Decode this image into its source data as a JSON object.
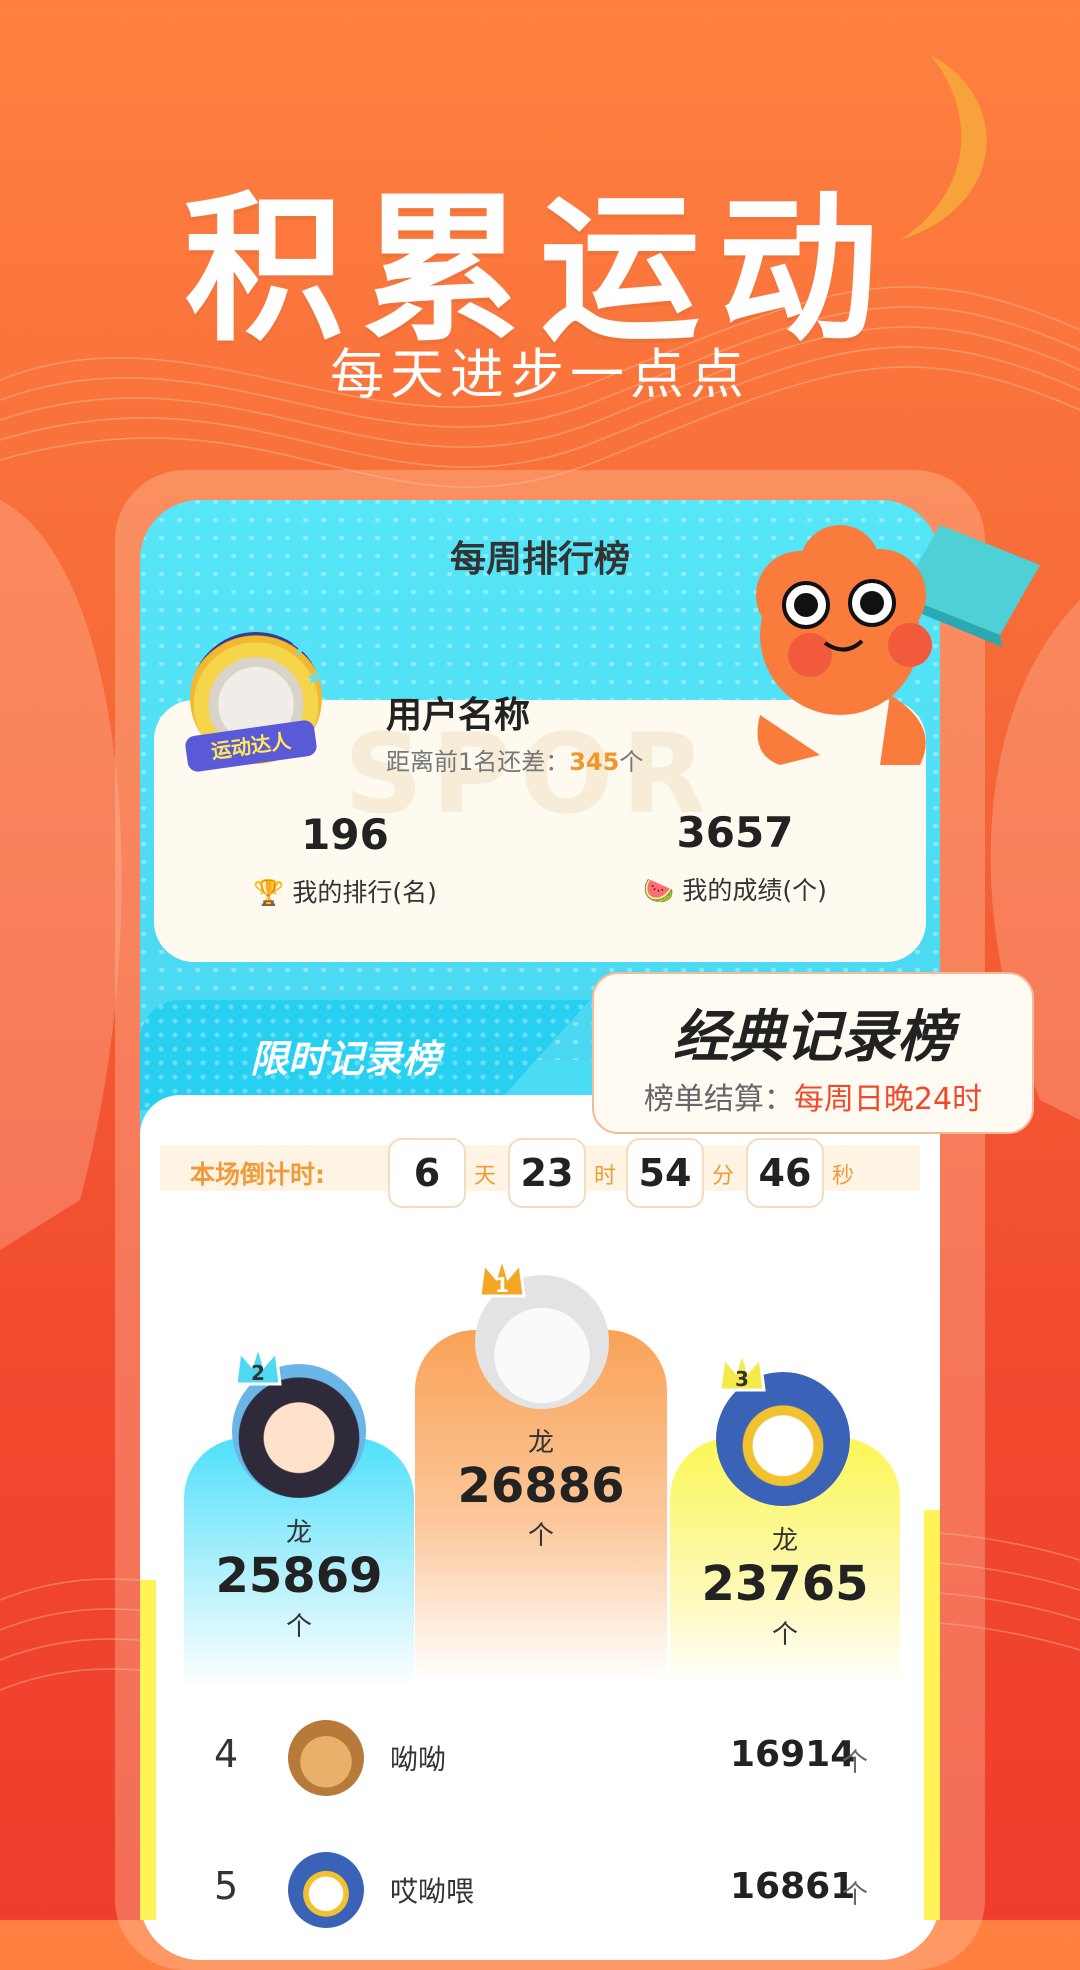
{
  "hero": {
    "title": "积累运动",
    "subtitle": "每天进步一点点"
  },
  "board": {
    "title": "每周排行榜",
    "watermark": "SPOR"
  },
  "user": {
    "name": "用户名称",
    "gap_prefix": "距离前1名还差：",
    "gap_value": "345",
    "gap_unit": "个",
    "badge": "运动达人",
    "rank_value": "196",
    "rank_label": "我的排行(名)",
    "score_value": "3657",
    "score_label": "我的成绩(个)"
  },
  "tabs": {
    "limited": "限时记录榜",
    "classic": "经典记录榜",
    "classic_sub_prefix": "榜单结算：",
    "classic_sub_value": "每周日晚24时"
  },
  "countdown": {
    "label": "本场倒计时:",
    "days": "6",
    "days_unit": "天",
    "hours": "23",
    "hours_unit": "时",
    "minutes": "54",
    "minutes_unit": "分",
    "seconds": "46",
    "seconds_unit": "秒"
  },
  "podium": {
    "first": {
      "rank": "1",
      "name": "龙",
      "score": "26886",
      "unit": "个"
    },
    "second": {
      "rank": "2",
      "name": "龙",
      "score": "25869",
      "unit": "个"
    },
    "third": {
      "rank": "3",
      "name": "龙",
      "score": "23765",
      "unit": "个"
    }
  },
  "list": [
    {
      "rank": "4",
      "name": "呦呦",
      "score": "16914",
      "unit": "个"
    },
    {
      "rank": "5",
      "name": "哎呦喂",
      "score": "16861",
      "unit": "个"
    }
  ],
  "colors": {
    "brand_orange": "#f66a38",
    "accent_cyan": "#4bdcf5",
    "highlight_orange": "#f2962a",
    "highlight_red": "#ef4a2a"
  }
}
